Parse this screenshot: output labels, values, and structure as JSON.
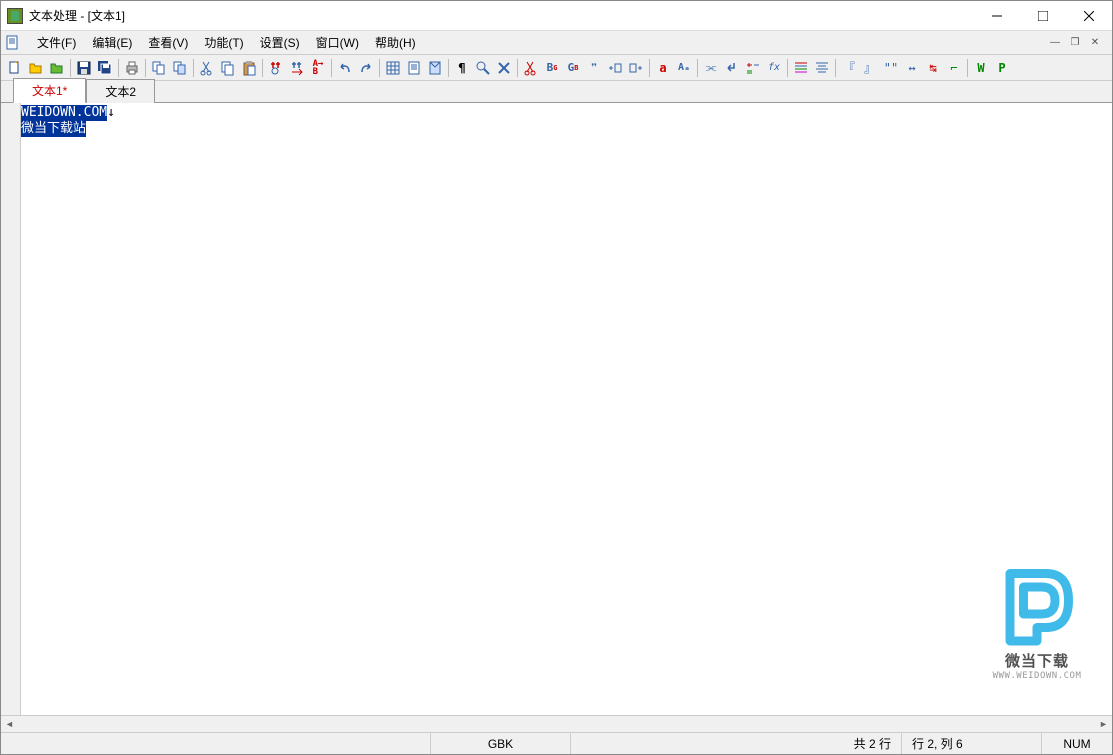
{
  "title": "文本处理 - [文本1]",
  "menus": {
    "file": "文件(F)",
    "edit": "编辑(E)",
    "view": "查看(V)",
    "func": "功能(T)",
    "settings": "设置(S)",
    "window": "窗口(W)",
    "help": "帮助(H)"
  },
  "tabs": {
    "t1": "文本1*",
    "t2": "文本2"
  },
  "editor": {
    "line1_sel": "WEIDOWN.COM",
    "line1_suffix": "↓",
    "line2_sel": "微当下载站"
  },
  "status": {
    "encoding": "GBK",
    "lines": "共 2 行",
    "pos": "行 2, 列 6",
    "num": "NUM"
  },
  "toolbar_icons": {
    "new": "new",
    "open": "open",
    "openfolder": "openfolder",
    "save": "save",
    "saveall": "saveall",
    "print": "print",
    "copy1": "cp1",
    "copy2": "cp2",
    "cut": "cut",
    "copy": "copy",
    "paste": "paste",
    "find": "find",
    "findnext": "findnext",
    "replace": "replace",
    "undo": "undo",
    "redo": "redo",
    "props": "props",
    "doc": "doc",
    "page": "page",
    "para": "para",
    "tool1": "t1",
    "tool2": "t2",
    "cutx": "cutx",
    "bold": "B",
    "g1": "G",
    "pmark": "¶",
    "f1": "f1",
    "f2": "f2",
    "acase": "a",
    "aall": "A",
    "u1": "u1",
    "u2": "u2",
    "calc": "calc",
    "eq": "=",
    "indent": "ind",
    "just": "just",
    "brk1": "『",
    "brk2": "』",
    "quote": "\"",
    "hr1": "↔",
    "hr2": "↔",
    "ang": "∟",
    "w": "W",
    "p": "P"
  },
  "watermark": {
    "text": "微当下载",
    "url": "WWW.WEIDOWN.COM"
  }
}
